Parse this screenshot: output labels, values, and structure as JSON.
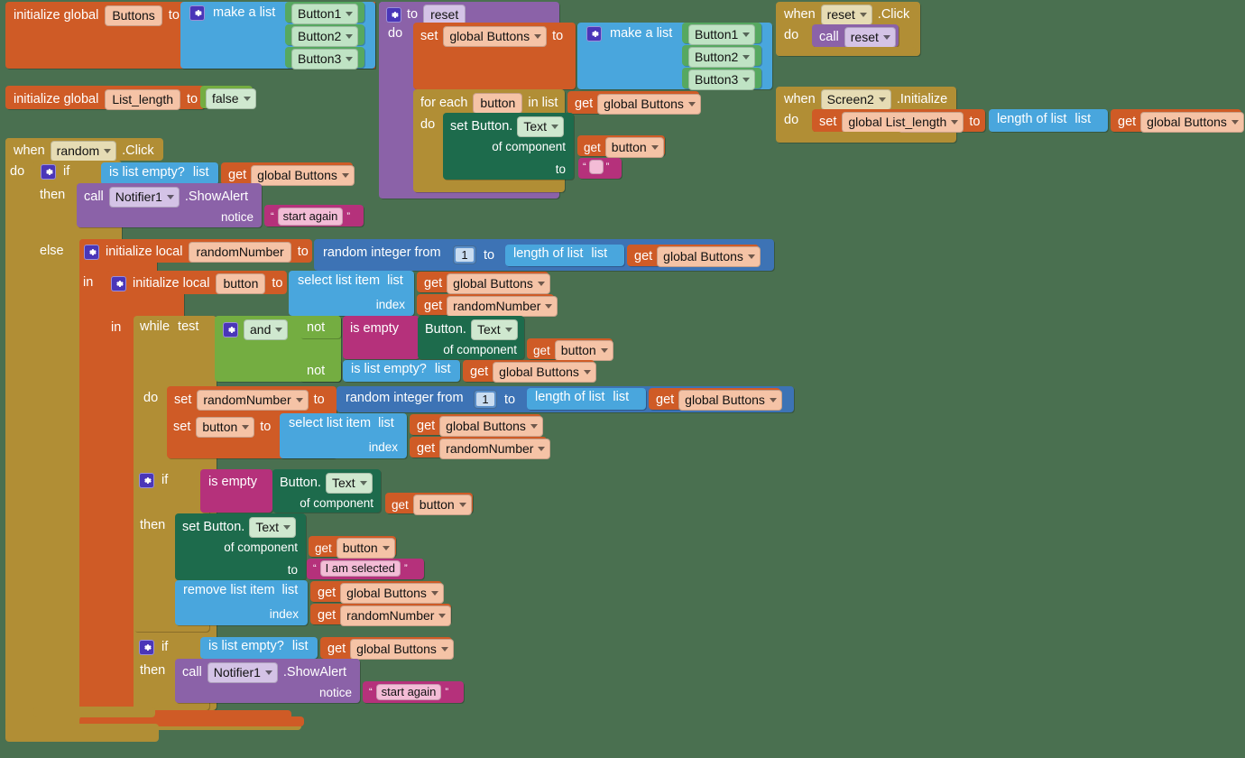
{
  "editor": {
    "name": "MIT App Inventor blocks editor workspace",
    "background_color": "#4a7050"
  },
  "palette": {
    "variable_color": "#cf5b26",
    "list_color": "#49a6dd",
    "control_color": "#b18e35",
    "logic_color": "#74ad41",
    "text_color": "#b5317b",
    "procedure_color": "#8b62a8",
    "component_color": "#1d6b4c",
    "math_color": "#3d73b5"
  },
  "words": {
    "initialize_global": "initialize global",
    "initialize_local": "initialize local",
    "to": "to",
    "in": "in",
    "do": "do",
    "if": "if",
    "then": "then",
    "else": "else",
    "when": "when",
    "call": "call",
    "set": "set",
    "get": "get",
    "make_a_list": "make a list",
    "for_each": "for each",
    "in_list": "in list",
    "while": "while",
    "test": "test",
    "not": "not",
    "and": "and",
    "is_empty": "is empty",
    "is_list_empty": "is list empty?",
    "list": "list",
    "index": "index",
    "length_of_list": "length of list",
    "select_list_item": "select list item",
    "remove_list_item": "remove list item",
    "random_integer_from": "random integer from",
    "of_component": "of component",
    "notice": "notice",
    "set_button_text": "set Button.",
    "button_dot": "Button.",
    "quote_open": "“",
    "quote_close": "”"
  },
  "blocks": {
    "init_global_buttons": {
      "label": "initialize global",
      "variable": "Buttons",
      "to": "to",
      "make_a_list": "make a list",
      "items": [
        "Button1",
        "Button2",
        "Button3"
      ]
    },
    "init_global_list_length": {
      "label": "initialize global",
      "variable": "List_length",
      "to": "to",
      "value": "false"
    },
    "procedure_reset": {
      "to": "to",
      "name": "reset",
      "do": "do",
      "set_label": "set",
      "set_target": "global Buttons",
      "set_to": "to",
      "make_a_list": "make a list",
      "items": [
        "Button1",
        "Button2",
        "Button3"
      ],
      "for_each": "for each",
      "loop_var": "button",
      "in_list": "in list",
      "get": "get",
      "get_target": "global Buttons",
      "inner_do": "do",
      "set_component_label": "set Button.",
      "property": "Text",
      "of_component": "of component",
      "component_get": "get",
      "component_var": "button",
      "to_label": "to",
      "text_value": ""
    },
    "when_reset_click": {
      "when": "when",
      "component": "reset",
      "event": ".Click",
      "do": "do",
      "call": "call",
      "procedure": "reset"
    },
    "when_screen2_initialize": {
      "when": "when",
      "component": "Screen2",
      "event": ".Initialize",
      "do": "do",
      "set": "set",
      "set_target": "global List_length",
      "to": "to",
      "length_of_list": "length of list",
      "list": "list",
      "get": "get",
      "get_target": "global Buttons"
    },
    "when_random_click": {
      "when": "when",
      "component": "random",
      "event": ".Click",
      "do": "do",
      "if": "if",
      "if_test_label": "is list empty?",
      "if_test_list": "list",
      "if_test_get": "get",
      "if_test_target": "global Buttons",
      "then": "then",
      "then_call": "call",
      "then_component": "Notifier1",
      "then_method": ".ShowAlert",
      "then_notice_label": "notice",
      "then_notice_text": "start again",
      "else": "else",
      "local_randomNumber": {
        "initialize_local": "initialize local",
        "name": "randomNumber",
        "to": "to",
        "random_integer_from": "random integer from",
        "from_value": "1",
        "to_label": "to",
        "length_of_list": "length of list",
        "list": "list",
        "get": "get",
        "get_target": "global Buttons",
        "in": "in"
      },
      "local_button": {
        "initialize_local": "initialize local",
        "name": "button",
        "to": "to",
        "select_list_item": "select list item",
        "list": "list",
        "list_get": "get",
        "list_target": "global Buttons",
        "index": "index",
        "index_get": "get",
        "index_target": "randomNumber",
        "in": "in"
      },
      "while_loop": {
        "while": "while",
        "test": "test",
        "and": "and",
        "not1": "not",
        "is_empty": "is empty",
        "comp1_label": "Button.",
        "comp1_property": "Text",
        "comp1_of_component": "of component",
        "comp1_get": "get",
        "comp1_var": "button",
        "not2": "not",
        "is_list_empty": "is list empty?",
        "list2": "list",
        "list2_get": "get",
        "list2_target": "global Buttons",
        "do": "do",
        "set_randomNumber": "randomNumber",
        "set_label": "set",
        "set_to": "to",
        "random_integer_from": "random integer from",
        "from_value": "1",
        "to_label": "to",
        "length_of_list": "length of list",
        "length_list": "list",
        "length_get": "get",
        "length_target": "global Buttons",
        "set_button_label": "set",
        "set_button_var": "button",
        "set_button_to": "to",
        "select_list_item": "select list item",
        "sel_list": "list",
        "sel_get": "get",
        "sel_target": "global Buttons",
        "sel_index": "index",
        "sel_index_get": "get",
        "sel_index_target": "randomNumber"
      },
      "if_is_empty": {
        "if": "if",
        "is_empty": "is empty",
        "comp_label": "Button.",
        "comp_property": "Text",
        "of_component": "of component",
        "comp_get": "get",
        "comp_var": "button",
        "then": "then",
        "set_component_label": "set Button.",
        "set_property": "Text",
        "set_of_component": "of component",
        "set_comp_get": "get",
        "set_comp_var": "button",
        "set_to": "to",
        "set_text": "I am selected",
        "remove_list_item": "remove list item",
        "remove_list": "list",
        "remove_get": "get",
        "remove_target": "global Buttons",
        "remove_index": "index",
        "remove_index_get": "get",
        "remove_index_target": "randomNumber"
      },
      "if_list_empty": {
        "if": "if",
        "is_list_empty": "is list empty?",
        "list": "list",
        "get": "get",
        "get_target": "global Buttons",
        "then": "then",
        "call": "call",
        "component": "Notifier1",
        "method": ".ShowAlert",
        "notice_label": "notice",
        "notice_text": "start again"
      }
    }
  }
}
